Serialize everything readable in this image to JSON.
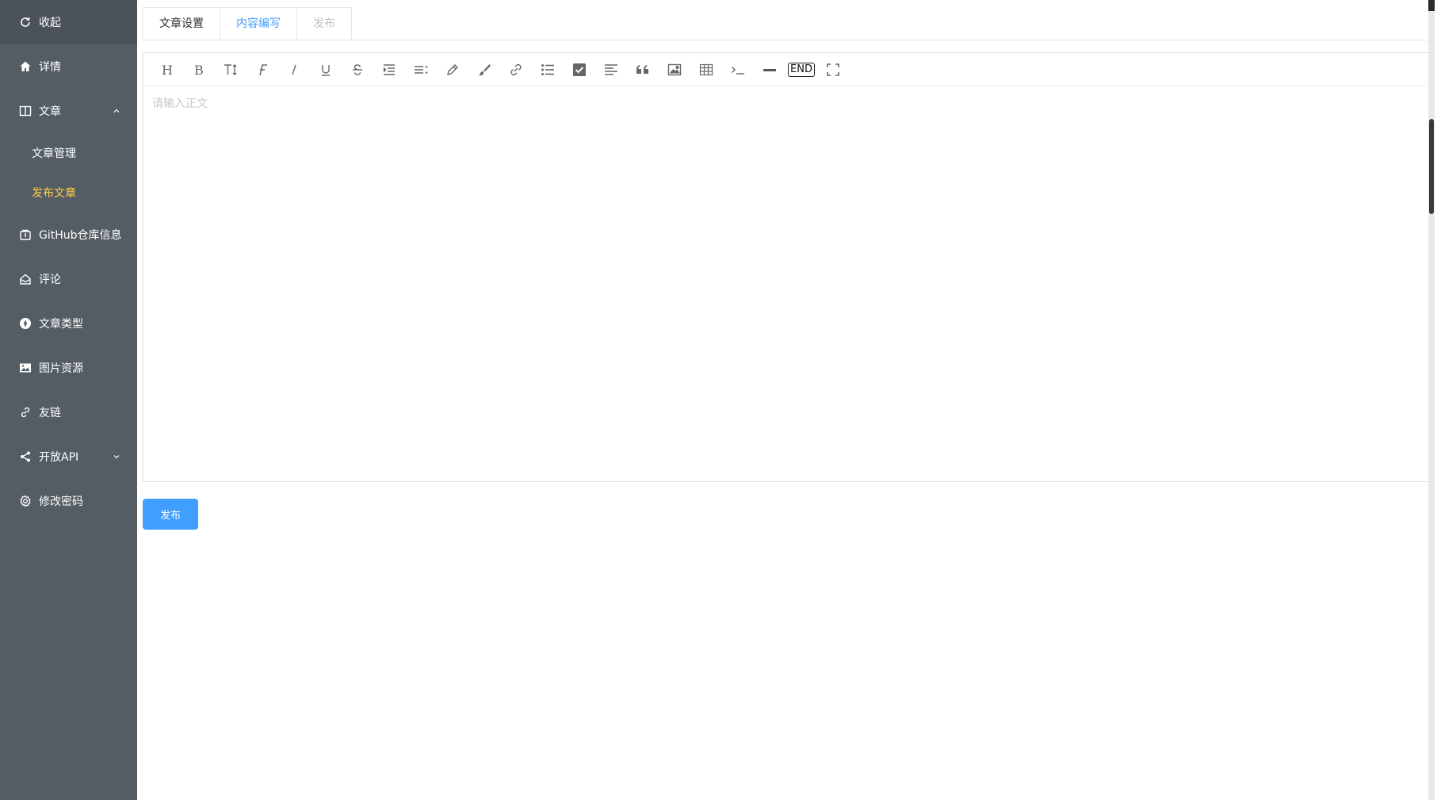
{
  "sidebar": {
    "collapse": {
      "label": "收起",
      "icon": "refresh-icon"
    },
    "items": [
      {
        "label": "详情",
        "icon": "home-icon"
      },
      {
        "label": "文章",
        "icon": "book-icon",
        "expanded": true,
        "children": [
          {
            "label": "文章管理",
            "active": false
          },
          {
            "label": "发布文章",
            "active": true
          }
        ]
      },
      {
        "label": "GitHub仓库信息",
        "icon": "repo-icon"
      },
      {
        "label": "评论",
        "icon": "comment-icon"
      },
      {
        "label": "文章类型",
        "icon": "category-icon"
      },
      {
        "label": "图片资源",
        "icon": "image-icon"
      },
      {
        "label": "友链",
        "icon": "link-icon"
      },
      {
        "label": "开放API",
        "icon": "share-icon",
        "expanded": false
      },
      {
        "label": "修改密码",
        "icon": "gear-icon"
      }
    ],
    "colors": {
      "background": "#545c64",
      "active_text": "#ffd04b",
      "text": "#ffffff"
    }
  },
  "tabs": [
    {
      "label": "文章设置",
      "state": "normal"
    },
    {
      "label": "内容编写",
      "state": "active"
    },
    {
      "label": "发布",
      "state": "disabled"
    }
  ],
  "editor": {
    "toolbar": [
      "heading-icon",
      "bold-icon",
      "text-size-icon",
      "font-icon",
      "italic-icon",
      "underline-icon",
      "strikethrough-icon",
      "indent-icon",
      "line-height-icon",
      "pen-icon",
      "brush-icon",
      "link-icon",
      "list-icon",
      "checkbox-icon",
      "align-icon",
      "quote-icon",
      "image-icon",
      "table-icon",
      "code-icon",
      "hr-icon",
      "end-icon",
      "fullscreen-icon"
    ],
    "end_label": "END",
    "placeholder": "请输入正文"
  },
  "actions": {
    "publish_label": "发布"
  },
  "colors": {
    "primary": "#409eff"
  }
}
